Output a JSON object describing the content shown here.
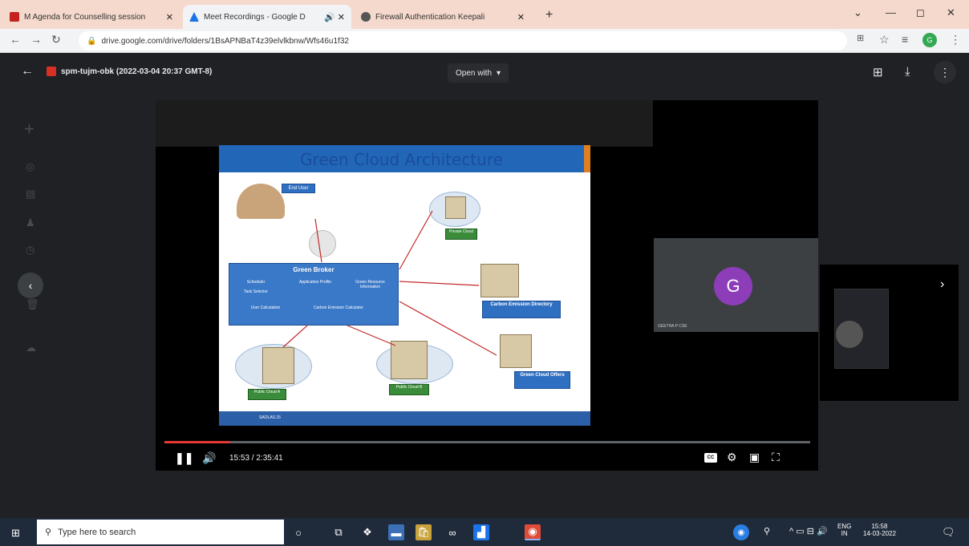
{
  "browser": {
    "tabs": [
      {
        "title": "M  Agenda for Counselling session",
        "favicon_color": "#c5221f"
      },
      {
        "title": "Meet Recordings - Google D",
        "favicon_color": "#1a73e8"
      },
      {
        "title": "Firewall Authentication Keepali",
        "favicon_color": "#555555"
      }
    ],
    "new_tab": "+",
    "url": "drive.google.com/drive/folders/1BsAPNBaT4z39elvlkbnw/Wfs46u1f32"
  },
  "viewer": {
    "file_title": "spm-tujm-obk (2022-03-04 20:37 GMT-8)",
    "open_with": "Open with"
  },
  "slide": {
    "title": "Green Cloud Architecture",
    "end_user": "End User",
    "broker": "Green Broker",
    "broker_parts": [
      "Scheduler",
      "Application Profile",
      "Green Resource Information",
      "Task Selector",
      "User Calculation",
      "Carbon Emission Calculator"
    ],
    "private_cloud": "Private Cloud",
    "carbon_directory": "Carbon Emission Directory",
    "green_offers": "Green Cloud Offers",
    "public_cloud_a": "Public Cloud A",
    "public_cloud_b": "Public Cloud B",
    "footer": "SAOLAS.15"
  },
  "participant": {
    "initial": "G",
    "name": "GEETHA P CSE"
  },
  "player": {
    "time": "15:53 / 2:35:41",
    "progress": 0.102,
    "cc": "CC"
  },
  "taskbar": {
    "search_placeholder": "Type here to search",
    "lang": "ENG",
    "region": "IN",
    "clock_time": "15:58",
    "clock_date": "14-03-2022"
  },
  "colors": {
    "accent_red": "#e53935",
    "avatar_purple": "#8e3db8",
    "tab_strip": "#f5d9cc"
  }
}
